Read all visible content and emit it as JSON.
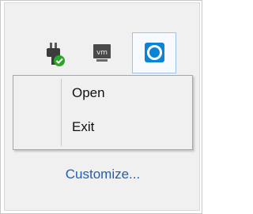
{
  "tray": {
    "icons": [
      {
        "name": "usb-plug-check-icon"
      },
      {
        "name": "vmware-tray-icon",
        "label": "vm"
      },
      {
        "name": "app-circle-icon"
      }
    ],
    "context_menu": {
      "items": [
        "Open",
        "Exit"
      ]
    },
    "customize_label": "Customize..."
  },
  "colors": {
    "accent": "#0a84d6",
    "link": "#1f5fb8",
    "check_green": "#2aa52a"
  }
}
